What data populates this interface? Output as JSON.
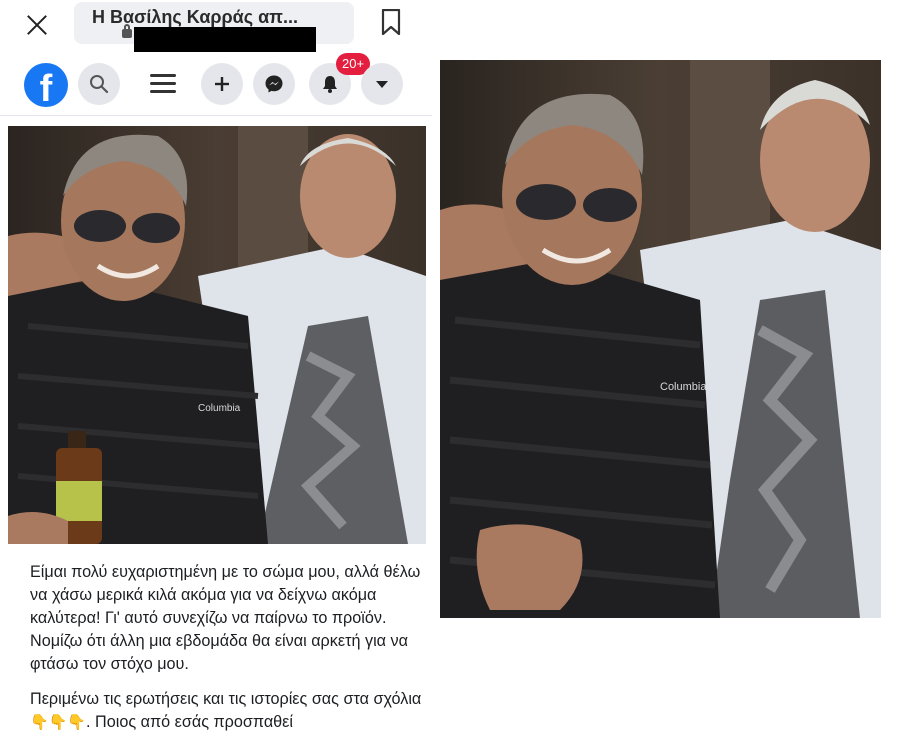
{
  "browser": {
    "page_title": "Η Βασίλης Καρράς απ...",
    "close_icon": "close-icon",
    "bookmark_icon": "bookmark-icon",
    "lock_icon": "lock-icon"
  },
  "facebook_nav": {
    "logo_letter": "f",
    "notification_count": "20+",
    "icons": [
      "facebook-logo",
      "search-icon",
      "menu-icon",
      "plus-icon",
      "messenger-icon",
      "bell-icon",
      "caret-down-icon"
    ],
    "brand_color": "#1877f2",
    "badge_color": "#e41e3f"
  },
  "post": {
    "paragraph_1": "Είμαι πολύ ευχαριστημένη με το σώμα μου, αλλά θέλω να χάσω μερικά κιλά ακόμα για να δείχνω ακόμα καλύτερα! Γι' αυτό συνεχίζω να παίρνω το προϊόν. Νομίζω ότι άλλη μια εβδομάδα θα είναι αρκετή για να φτάσω τον στόχο μου.",
    "paragraph_2_start": "Περιμένω τις ερωτήσεις και τις ιστορίες σας στα σχόλια",
    "paragraph_2_emoji": "👇👇👇",
    "paragraph_2_end": ". Ποιος από εσάς προσπαθεί"
  },
  "photos": {
    "left_label": "Columbia",
    "right_label": "Columbia"
  }
}
